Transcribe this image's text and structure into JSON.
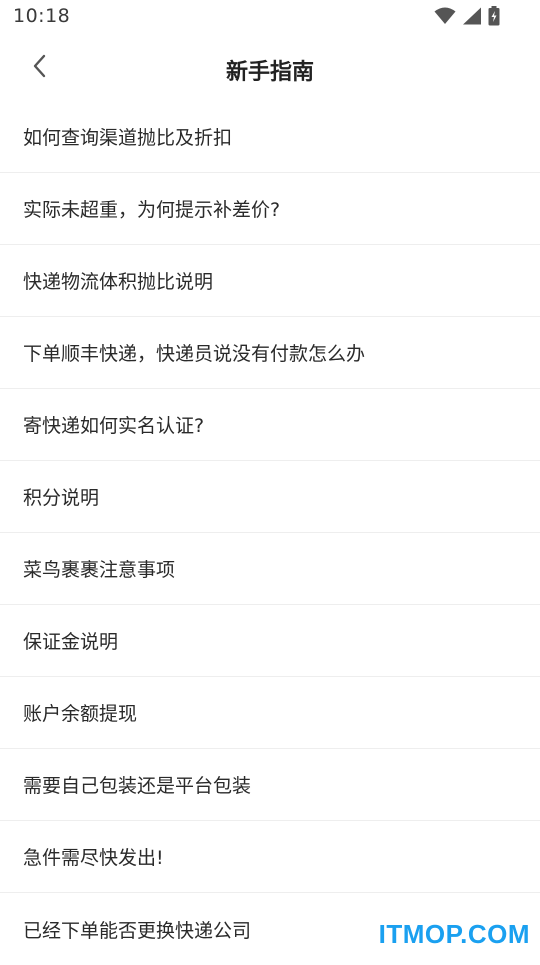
{
  "status_bar": {
    "time": "10:18",
    "icons": [
      "wifi-icon",
      "signal-icon",
      "battery-charging-icon"
    ]
  },
  "nav": {
    "title": "新手指南",
    "back_icon": "chevron-left-icon"
  },
  "guide": {
    "items": [
      {
        "label": "如何查询渠道抛比及折扣"
      },
      {
        "label": "实际未超重，为何提示补差价?"
      },
      {
        "label": "快递物流体积抛比说明"
      },
      {
        "label": "下单顺丰快递，快递员说没有付款怎么办"
      },
      {
        "label": "寄快递如何实名认证?"
      },
      {
        "label": "积分说明"
      },
      {
        "label": "菜鸟裹裹注意事项"
      },
      {
        "label": "保证金说明"
      },
      {
        "label": "账户余额提现"
      },
      {
        "label": "需要自己包装还是平台包装"
      },
      {
        "label": "急件需尽快发出!"
      },
      {
        "label": "已经下单能否更换快递公司"
      }
    ]
  },
  "watermark": {
    "text": "ITMOP.COM",
    "color": "#1aa0f0"
  }
}
